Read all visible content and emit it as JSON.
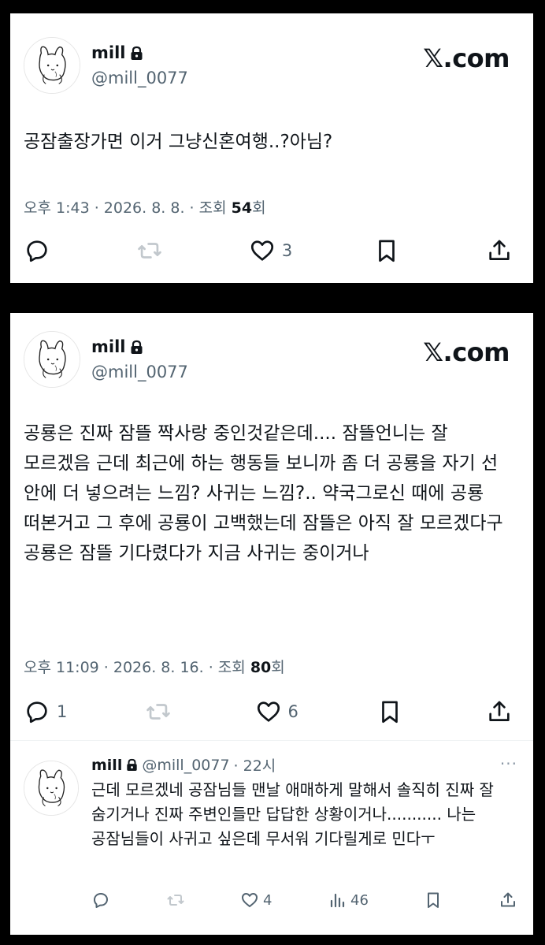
{
  "brand": "𝕏.com",
  "tweet1": {
    "name": "mill",
    "handle": "@mill_0077",
    "text": "공잠출장가면 이거 그냥신혼여행..?아님?",
    "meta_prefix": "오후 1:43 · 2026. 8. 8. · 조회 ",
    "views": "54",
    "meta_suffix": "회",
    "likes": "3",
    "replies": "",
    "icons": [
      "reply-icon",
      "retweet-icon",
      "like-icon",
      "bookmark-icon",
      "share-icon"
    ]
  },
  "tweet2": {
    "name": "mill",
    "handle": "@mill_0077",
    "text": "공룡은 진짜 잠뜰 짝사랑 중인것같은데.... 잠뜰언니는 잘 모르겠음 근데 최근에 하는 행동들 보니까 좀 더 공룡을 자기 선 안에 더 넣으려는 느낌? 사귀는 느낌?.. 약국그로신 때에 공룡 떠본거고 그 후에 공룡이 고백했는데 잠뜰은 아직 잘 모르겠다구 공룡은 잠뜰 기다렸다가 지금 사귀는 중이거나",
    "meta_prefix": "오후 11:09 · 2026. 8. 16. · 조회 ",
    "views": "80",
    "meta_suffix": "회",
    "replies": "1",
    "likes": "6"
  },
  "reply": {
    "name": "mill",
    "handle": "@mill_0077",
    "time": "· 22시",
    "more": "···",
    "text": "근데 모르겠네 공잠님들 맨날 애매하게 말해서 솔직히 진짜 잘 숨기거나 진짜 주변인들만 답답한 상황이거나........... 나는 공잠님들이 사귀고 싶은데 무서워 기다릴게로 민다ㅜ",
    "likes": "4",
    "views": "46"
  }
}
